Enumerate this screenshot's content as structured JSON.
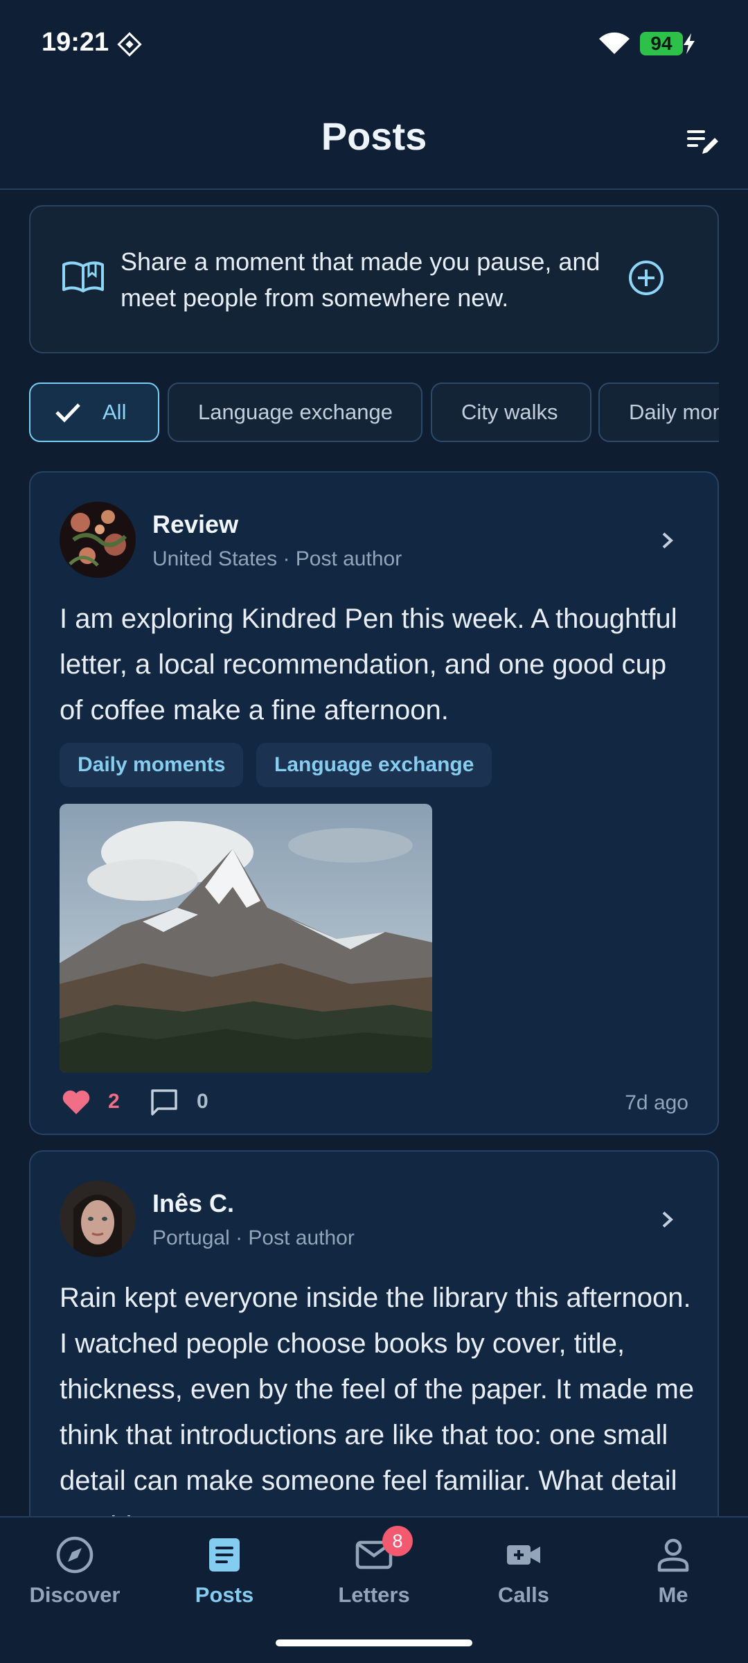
{
  "status_bar": {
    "time": "19:21",
    "battery": "94"
  },
  "header": {
    "title": "Posts"
  },
  "banner": {
    "text": "Share a moment that made you pause, and meet people from somewhere new."
  },
  "filters": [
    {
      "label": "All",
      "selected": true
    },
    {
      "label": "Language exchange",
      "selected": false
    },
    {
      "label": "City walks",
      "selected": false
    },
    {
      "label": "Daily moments",
      "selected": false
    }
  ],
  "posts": [
    {
      "author": "Review",
      "meta": "United States · Post author",
      "text": "I am exploring Kindred Pen this week. A thoughtful letter, a local recommendation, and one good cup of coffee make a fine afternoon.",
      "tags": [
        "Daily moments",
        "Language exchange"
      ],
      "likes": "2",
      "comments": "0",
      "time": "7d ago"
    },
    {
      "author": "Inês C.",
      "meta": "Portugal · Post author",
      "text": "Rain kept everyone inside the library this afternoon. I watched people choose books by cover, title, thickness, even by the feel of the paper. It made me think that introductions are like that too: one small detail can make someone feel familiar. What detail would"
    }
  ],
  "nav": [
    {
      "label": "Discover",
      "icon": "compass-icon"
    },
    {
      "label": "Posts",
      "icon": "posts-icon",
      "active": true
    },
    {
      "label": "Letters",
      "icon": "mail-icon",
      "badge": "8"
    },
    {
      "label": "Calls",
      "icon": "video-call-icon"
    },
    {
      "label": "Me",
      "icon": "person-icon"
    }
  ],
  "colors": {
    "accent": "#84cdf1",
    "like": "#f06e86",
    "badge": "#f3596f",
    "background": "#0f1d30"
  }
}
